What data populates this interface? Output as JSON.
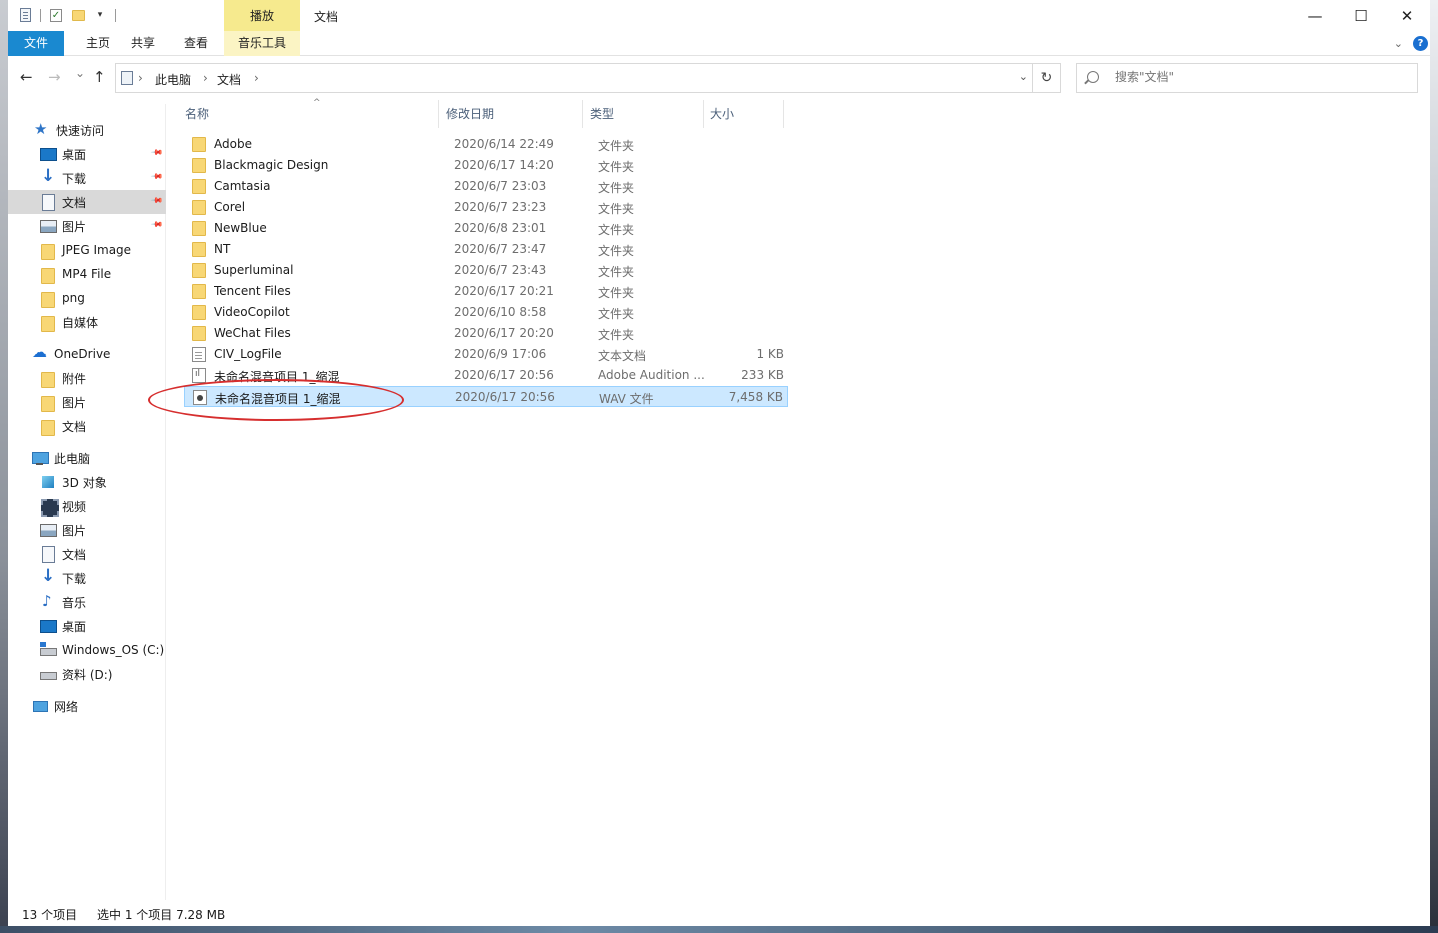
{
  "titlebar": {
    "context_tab": "播放",
    "title": "文档",
    "minimize": "—",
    "maximize": "☐",
    "close": "✕"
  },
  "ribbon": {
    "tabs": [
      "文件",
      "主页",
      "共享",
      "查看",
      "音乐工具"
    ],
    "help": "?"
  },
  "nav": {
    "back": "←",
    "forward": "→",
    "recent": "⌄",
    "up": "↑",
    "breadcrumb": [
      "此电脑",
      "文档"
    ],
    "sep": "›",
    "dropdown": "⌄",
    "refresh": "↻",
    "search_placeholder": "搜索\"文档\""
  },
  "sidebar": {
    "items": [
      {
        "label": "快速访问",
        "icon": "star-icon",
        "pinned": false
      },
      {
        "label": "桌面",
        "icon": "desktop-icon",
        "pinned": true
      },
      {
        "label": "下载",
        "icon": "download-icon",
        "pinned": true
      },
      {
        "label": "文档",
        "icon": "document-icon",
        "pinned": true,
        "selected": true
      },
      {
        "label": "图片",
        "icon": "pictures-icon",
        "pinned": true
      },
      {
        "label": "JPEG Image",
        "icon": "folder-icon"
      },
      {
        "label": "MP4 File",
        "icon": "folder-icon"
      },
      {
        "label": "png",
        "icon": "folder-icon"
      },
      {
        "label": "自媒体",
        "icon": "folder-icon"
      },
      {
        "label": "OneDrive",
        "icon": "onedrive-icon"
      },
      {
        "label": "附件",
        "icon": "folder-icon"
      },
      {
        "label": "图片",
        "icon": "folder-icon"
      },
      {
        "label": "文档",
        "icon": "folder-icon"
      },
      {
        "label": "此电脑",
        "icon": "computer-icon"
      },
      {
        "label": "3D 对象",
        "icon": "3d-objects-icon"
      },
      {
        "label": "视频",
        "icon": "video-icon"
      },
      {
        "label": "图片",
        "icon": "pictures-icon"
      },
      {
        "label": "文档",
        "icon": "document-icon"
      },
      {
        "label": "下载",
        "icon": "download-icon"
      },
      {
        "label": "音乐",
        "icon": "music-icon"
      },
      {
        "label": "桌面",
        "icon": "desktop-icon"
      },
      {
        "label": "Windows_OS (C:)",
        "icon": "windows-drive-icon"
      },
      {
        "label": "资料 (D:)",
        "icon": "drive-icon"
      },
      {
        "label": "网络",
        "icon": "network-icon"
      }
    ],
    "pin_glyph": "📌"
  },
  "list": {
    "columns": [
      "名称",
      "修改日期",
      "类型",
      "大小"
    ],
    "sort_glyph": "^",
    "rows": [
      {
        "name": "Adobe",
        "date": "2020/6/14 22:49",
        "type": "文件夹",
        "size": "",
        "icon": "folder-icon"
      },
      {
        "name": "Blackmagic Design",
        "date": "2020/6/17 14:20",
        "type": "文件夹",
        "size": "",
        "icon": "folder-icon"
      },
      {
        "name": "Camtasia",
        "date": "2020/6/7 23:03",
        "type": "文件夹",
        "size": "",
        "icon": "folder-icon"
      },
      {
        "name": "Corel",
        "date": "2020/6/7 23:23",
        "type": "文件夹",
        "size": "",
        "icon": "folder-icon"
      },
      {
        "name": "NewBlue",
        "date": "2020/6/8 23:01",
        "type": "文件夹",
        "size": "",
        "icon": "folder-icon"
      },
      {
        "name": "NT",
        "date": "2020/6/7 23:47",
        "type": "文件夹",
        "size": "",
        "icon": "folder-icon"
      },
      {
        "name": "Superluminal",
        "date": "2020/6/7 23:43",
        "type": "文件夹",
        "size": "",
        "icon": "folder-icon"
      },
      {
        "name": "Tencent Files",
        "date": "2020/6/17 20:21",
        "type": "文件夹",
        "size": "",
        "icon": "folder-icon"
      },
      {
        "name": "VideoCopilot",
        "date": "2020/6/10 8:58",
        "type": "文件夹",
        "size": "",
        "icon": "folder-icon"
      },
      {
        "name": "WeChat Files",
        "date": "2020/6/17 20:20",
        "type": "文件夹",
        "size": "",
        "icon": "folder-icon"
      },
      {
        "name": "CIV_LogFile",
        "date": "2020/6/9 17:06",
        "type": "文本文档",
        "size": "1 KB",
        "icon": "text-file-icon"
      },
      {
        "name": "未命名混音项目 1_缩混",
        "date": "2020/6/17 20:56",
        "type": "Adobe Audition ...",
        "size": "233 KB",
        "icon": "audition-file-icon"
      },
      {
        "name": "未命名混音项目 1_缩混",
        "date": "2020/6/17 20:56",
        "type": "WAV 文件",
        "size": "7,458 KB",
        "icon": "wav-file-icon",
        "selected": true
      }
    ]
  },
  "status": {
    "count": "13 个项目",
    "selection": "选中 1 个项目  7.28 MB"
  },
  "colors": {
    "file_tab": "#1a89d0",
    "context_tab": "#f6ea8e",
    "selection_bg": "#cce8ff",
    "annotation": "#d62e2e"
  }
}
